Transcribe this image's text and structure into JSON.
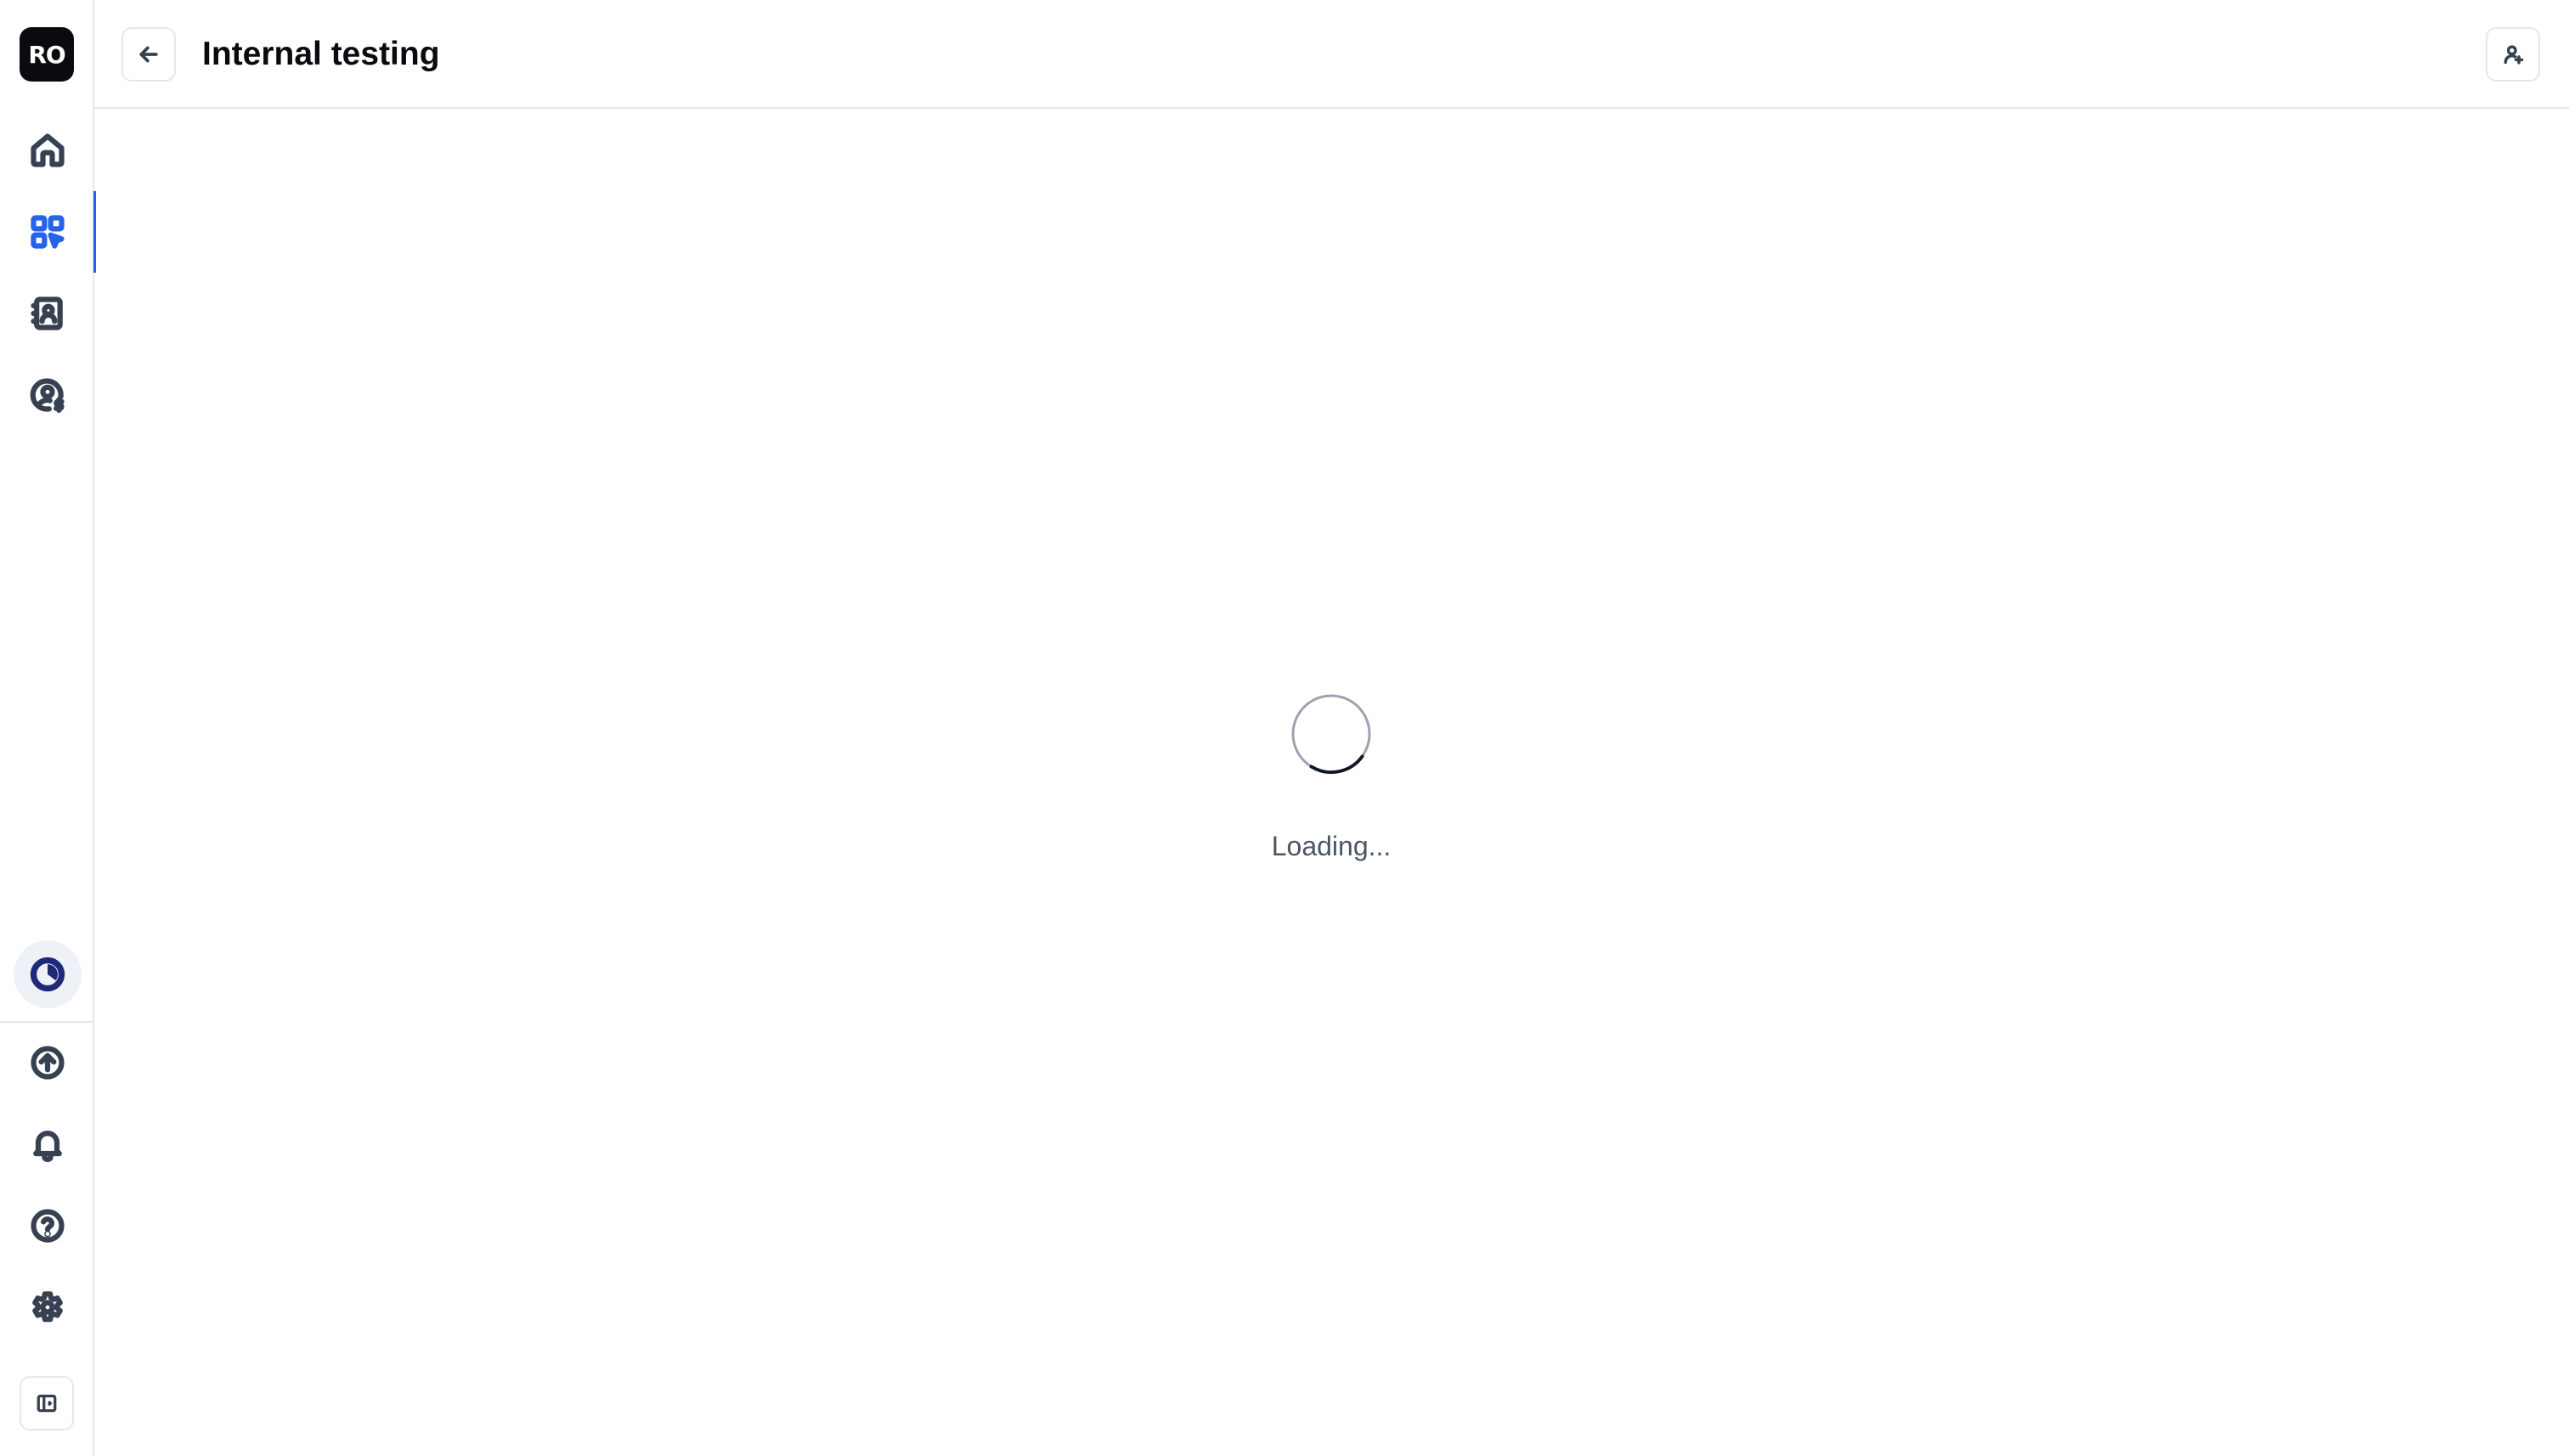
{
  "sidebar": {
    "logo_text": "RO",
    "items": [
      {
        "name": "home",
        "icon": "home-icon",
        "active": false
      },
      {
        "name": "apps",
        "icon": "apps-grid-icon",
        "active": true
      },
      {
        "name": "contacts",
        "icon": "contact-book-icon",
        "active": false
      },
      {
        "name": "billing",
        "icon": "user-dollar-icon",
        "active": false
      }
    ],
    "usage_icon": "pie-clock-icon",
    "bottom_items": [
      {
        "name": "upgrade",
        "icon": "arrow-up-circle-icon"
      },
      {
        "name": "notifications",
        "icon": "bell-icon"
      },
      {
        "name": "help",
        "icon": "help-circle-icon"
      },
      {
        "name": "settings",
        "icon": "gear-icon"
      }
    ],
    "collapse_icon": "sidebar-collapse-icon"
  },
  "header": {
    "title": "Internal testing",
    "back_icon": "arrow-left-icon",
    "user_icon": "user-add-icon"
  },
  "main": {
    "loading_text": "Loading..."
  },
  "colors": {
    "accent": "#2563eb",
    "logo_bg": "#0b0b0f",
    "border": "#e5e7eb",
    "icon": "#374151"
  }
}
